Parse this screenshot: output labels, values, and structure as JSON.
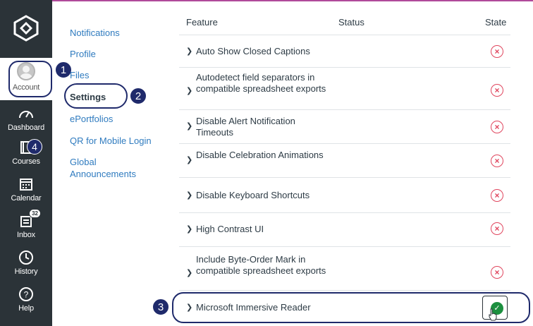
{
  "global_nav": {
    "account": "Account",
    "dashboard": "Dashboard",
    "courses": "Courses",
    "calendar": "Calendar",
    "inbox": "Inbox",
    "inbox_badge": "32",
    "history": "History",
    "help": "Help"
  },
  "annotations": {
    "one": "1",
    "two": "2",
    "three": "3",
    "four": "4"
  },
  "account_nav": {
    "items": [
      "Notifications",
      "Profile",
      "Files",
      "Settings",
      "ePortfolios",
      "QR for Mobile Login",
      "Global Announcements"
    ],
    "active": "Settings"
  },
  "table": {
    "headers": {
      "feature": "Feature",
      "status": "Status",
      "state": "State"
    },
    "rows": [
      {
        "name": "Auto Show Closed Captions",
        "enabled": false
      },
      {
        "name": "Autodetect field separators in compatible spreadsheet exports",
        "enabled": false
      },
      {
        "name": "Disable Alert Notification Timeouts",
        "enabled": false
      },
      {
        "name": "Disable Celebration Animations",
        "enabled": false
      },
      {
        "name": "Disable Keyboard Shortcuts",
        "enabled": false
      },
      {
        "name": "High Contrast UI",
        "enabled": false
      },
      {
        "name": "Include Byte-Order Mark in compatible spreadsheet exports",
        "enabled": false
      },
      {
        "name": "Microsoft Immersive Reader",
        "enabled": true
      }
    ]
  },
  "colors": {
    "nav_bg": "#2b3338",
    "link": "#2f7bbf",
    "off_state": "#e0465e",
    "on_state": "#1c8f3f",
    "annotation": "#1f2a6b"
  }
}
